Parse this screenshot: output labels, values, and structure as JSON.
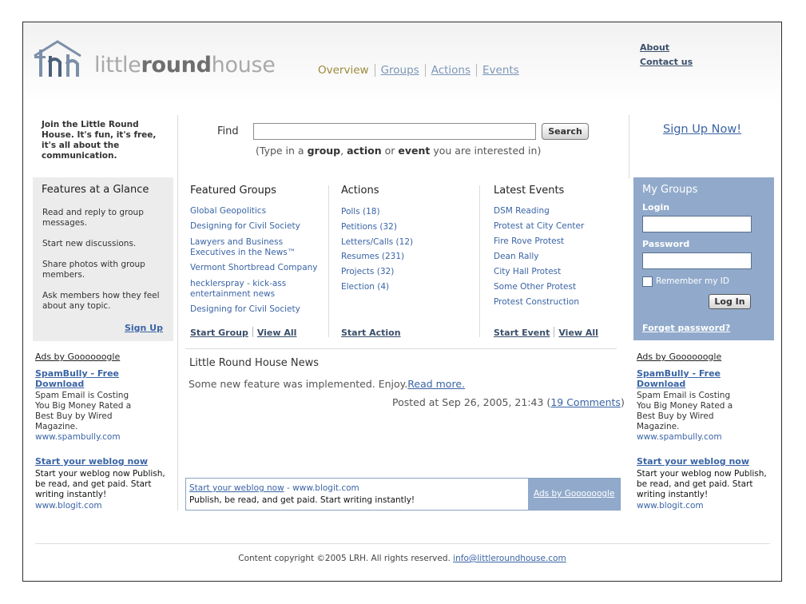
{
  "logo": {
    "text_light1": "little",
    "text_bold": "round",
    "text_light2": "house"
  },
  "topnav": {
    "items": [
      "Overview",
      "Groups",
      "Actions",
      "Events"
    ]
  },
  "toplinks": {
    "about": "About",
    "contact": "Contact us"
  },
  "intro": {
    "join_text": "Join the Little Round House. It's fun, it's free, it's all about the communication."
  },
  "search": {
    "label": "Find",
    "value": "",
    "button": "Search",
    "hint_pre": "(Type in a ",
    "hint_k1": "group",
    "hint_mid1": ", ",
    "hint_k2": "action",
    "hint_mid2": " or ",
    "hint_k3": "event",
    "hint_post": " you are interested in)"
  },
  "signup_big": "Sign Up Now!",
  "features": {
    "title": "Features at a Glance",
    "items": [
      "Read and reply to group messages.",
      "Start new discussions.",
      "Share photos with group members.",
      "Ask members how they feel about any topic."
    ],
    "signup": "Sign Up"
  },
  "featured_groups": {
    "title": "Featured Groups",
    "items": [
      "Global Geopolitics",
      "Designing for Civil Society",
      "Lawyers and Business Executives in the News™",
      "Vermont Shortbread Company",
      "hecklerspray - kick-ass entertainment news",
      "Designing for Civil Society"
    ],
    "start": "Start Group",
    "view_all": "View All"
  },
  "actions": {
    "title": "Actions",
    "items": [
      "Polls (18)",
      "Petitions (32)",
      "Letters/Calls (12)",
      "Resumes (231)",
      "Projects (32)",
      "Election (4)"
    ],
    "start": "Start Action"
  },
  "events": {
    "title": "Latest Events",
    "items": [
      "DSM Reading",
      "Protest at City Center",
      "Fire Rove Protest",
      "Dean Rally",
      "City Hall Protest",
      "Some Other Protest",
      "Protest Construction"
    ],
    "start": "Start Event",
    "view_all": "View All"
  },
  "my_groups": {
    "title": "My Groups",
    "login_label": "Login",
    "password_label": "Password",
    "login_value": "",
    "password_value": "",
    "remember": "Remember my ID",
    "remember_checked": false,
    "login_button": "Log In",
    "forgot": "Forget password?"
  },
  "news": {
    "title": "Little Round House News",
    "body": "Some new feature was implemented. Enjoy.",
    "read_more": "Read more.",
    "posted_pre": "Posted at Sep 26, 2005, 21:43 (",
    "comments": "19 Comments",
    "posted_post": ")"
  },
  "ads_left": {
    "header": "Ads by Goooooogle",
    "ad1_title": "SpamBully - Free Download",
    "ad1_body": "Spam Email is Costing You Big Money Rated a Best Buy by Wired Magazine.",
    "ad1_url": "www.spambully.com",
    "ad2_title": "Start your weblog now",
    "ad2_body": "Start your weblog now Publish, be read, and get paid. Start writing instantly!",
    "ad2_url": "www.blogit.com"
  },
  "ads_right": {
    "header": "Ads by Goooooogle",
    "ad1_title": "SpamBully - Free Download",
    "ad1_body": "Spam Email is Costing You Big Money Rated a Best Buy by Wired Magazine.",
    "ad1_url": "www.spambully.com",
    "ad2_title": "Start your weblog now",
    "ad2_body": "Start your weblog now Publish, be read, and get paid. Start writing instantly!",
    "ad2_url": "www.blogit.com"
  },
  "adbar": {
    "link": "Start your weblog now",
    "sep": " - ",
    "url": "www.blogit.com",
    "body": "Publish, be read, and get paid. Start writing instantly!",
    "ads_by": "Ads by Goooooogle"
  },
  "footer": {
    "text": "Content copyright ©2005 LRH. All rights reserved.",
    "email": "info@littleroundhouse.com"
  },
  "colors": {
    "accent_blue": "#3a64a5",
    "panel_blue": "#91aacb",
    "panel_gray": "#ececec",
    "overview_gold": "#9b8a3a"
  }
}
